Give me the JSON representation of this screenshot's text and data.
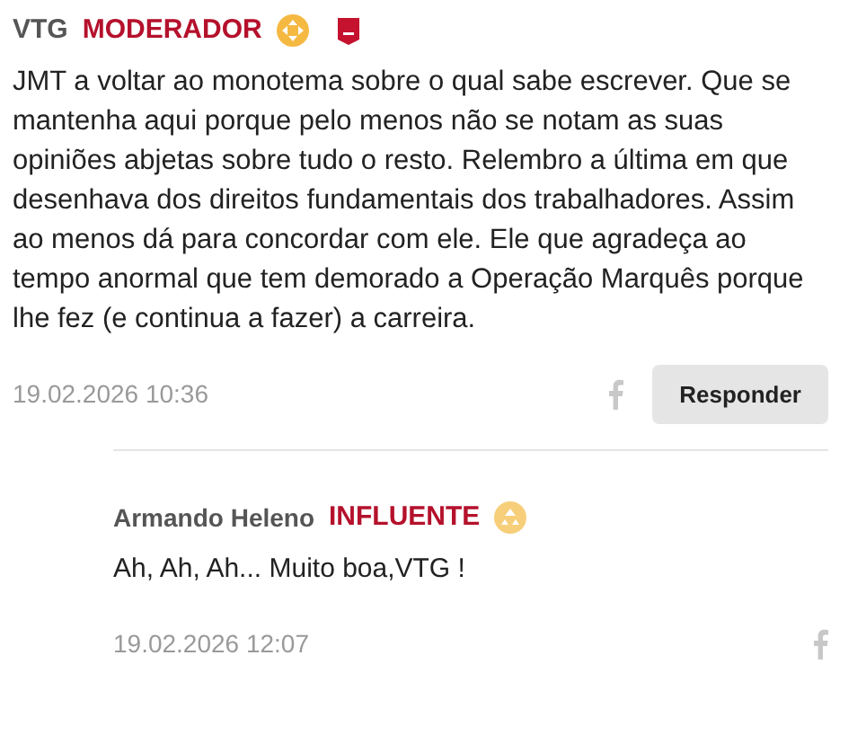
{
  "comments": [
    {
      "author": "VTG",
      "role": "MODERADOR",
      "kind": "moderator",
      "text": "JMT a voltar ao monotema sobre o qual sabe escrever. Que se mantenha aqui porque pelo menos não se notam as suas opiniões abjetas sobre tudo o resto. Relembro a última em que desenhava dos direitos fundamentais dos trabalhadores. Assim ao menos dá para concordar com ele. Ele que agradeça ao tempo anormal que tem demorado a Operação Marquês porque lhe fez (e continua a fazer) a carreira.",
      "date": "19.02.2026 10:36",
      "reply_button": "Responder"
    },
    {
      "author": "Armando Heleno",
      "role": "INFLUENTE",
      "kind": "influencer",
      "text": "Ah, Ah, Ah... Muito boa,VTG !",
      "date": "19.02.2026 12:07"
    }
  ]
}
